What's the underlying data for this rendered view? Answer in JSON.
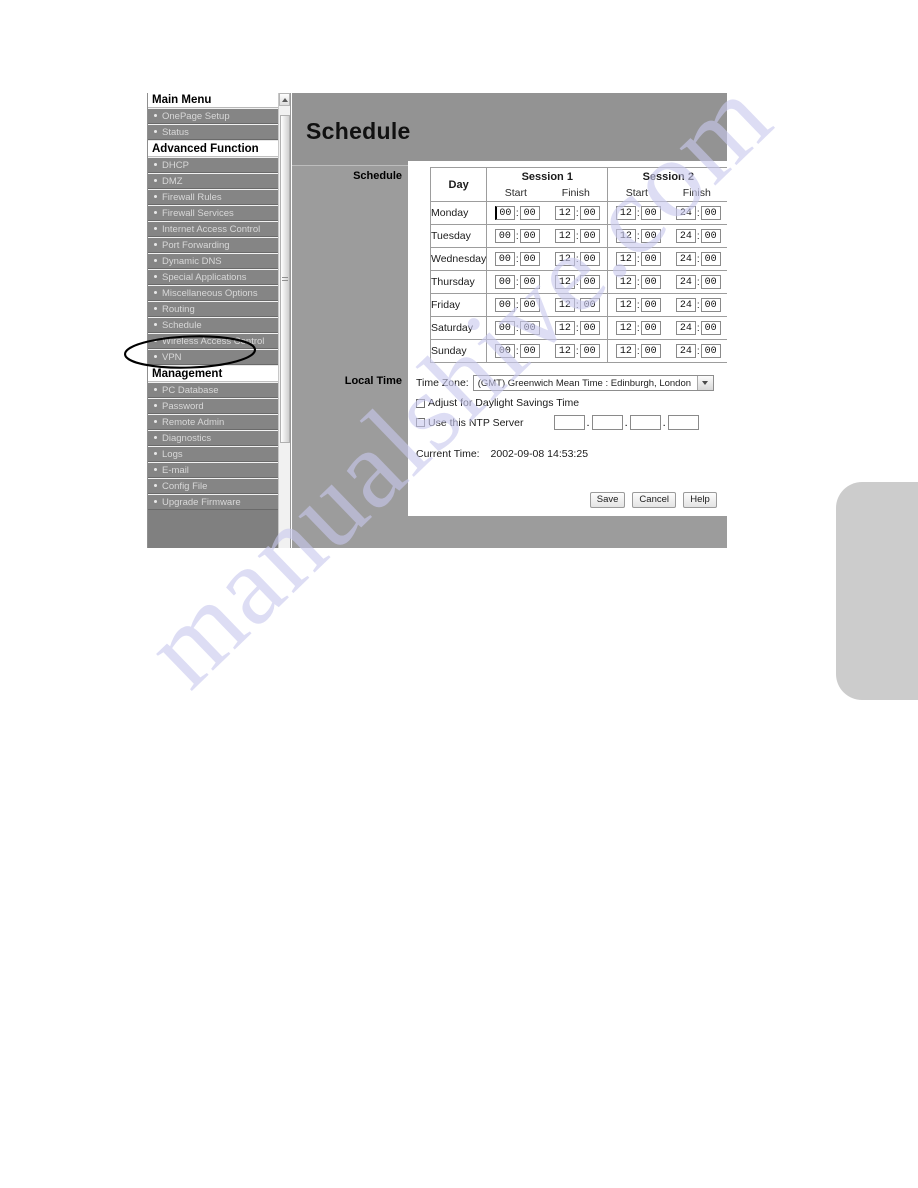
{
  "watermark": {
    "text": "manualshive.com"
  },
  "sidebar": {
    "main_menu_label": "Main Menu",
    "items_top": [
      {
        "label": "OnePage Setup"
      },
      {
        "label": "Status"
      }
    ],
    "section_advanced": "Advanced Function",
    "items_advanced": [
      {
        "label": "DHCP"
      },
      {
        "label": "DMZ"
      },
      {
        "label": "Firewall Rules"
      },
      {
        "label": "Firewall Services"
      },
      {
        "label": "Internet Access Control"
      },
      {
        "label": "Port Forwarding"
      },
      {
        "label": "Dynamic DNS"
      },
      {
        "label": "Special Applications"
      },
      {
        "label": "Miscellaneous Options"
      },
      {
        "label": "Routing"
      },
      {
        "label": "Schedule"
      },
      {
        "label": "Wireless Access Control"
      },
      {
        "label": "VPN"
      }
    ],
    "section_management": "Management",
    "items_management": [
      {
        "label": "PC Database"
      },
      {
        "label": "Password"
      },
      {
        "label": "Remote Admin"
      },
      {
        "label": "Diagnostics"
      },
      {
        "label": "Logs"
      },
      {
        "label": "E-mail"
      },
      {
        "label": "Config File"
      },
      {
        "label": "Upgrade Firmware"
      }
    ]
  },
  "content": {
    "page_title": "Schedule",
    "label_schedule": "Schedule",
    "label_local_time": "Local Time"
  },
  "schedule_table": {
    "header_day": "Day",
    "header_session1": "Session 1",
    "header_session2": "Session 2",
    "header_start": "Start",
    "header_finish": "Finish",
    "colon": ":",
    "rows": [
      {
        "day": "Monday",
        "s1_start_h": "00",
        "s1_start_m": "00",
        "s1_finish_h": "12",
        "s1_finish_m": "00",
        "s2_start_h": "12",
        "s2_start_m": "00",
        "s2_finish_h": "24",
        "s2_finish_m": "00"
      },
      {
        "day": "Tuesday",
        "s1_start_h": "00",
        "s1_start_m": "00",
        "s1_finish_h": "12",
        "s1_finish_m": "00",
        "s2_start_h": "12",
        "s2_start_m": "00",
        "s2_finish_h": "24",
        "s2_finish_m": "00"
      },
      {
        "day": "Wednesday",
        "s1_start_h": "00",
        "s1_start_m": "00",
        "s1_finish_h": "12",
        "s1_finish_m": "00",
        "s2_start_h": "12",
        "s2_start_m": "00",
        "s2_finish_h": "24",
        "s2_finish_m": "00"
      },
      {
        "day": "Thursday",
        "s1_start_h": "00",
        "s1_start_m": "00",
        "s1_finish_h": "12",
        "s1_finish_m": "00",
        "s2_start_h": "12",
        "s2_start_m": "00",
        "s2_finish_h": "24",
        "s2_finish_m": "00"
      },
      {
        "day": "Friday",
        "s1_start_h": "00",
        "s1_start_m": "00",
        "s1_finish_h": "12",
        "s1_finish_m": "00",
        "s2_start_h": "12",
        "s2_start_m": "00",
        "s2_finish_h": "24",
        "s2_finish_m": "00"
      },
      {
        "day": "Saturday",
        "s1_start_h": "00",
        "s1_start_m": "00",
        "s1_finish_h": "12",
        "s1_finish_m": "00",
        "s2_start_h": "12",
        "s2_start_m": "00",
        "s2_finish_h": "24",
        "s2_finish_m": "00"
      },
      {
        "day": "Sunday",
        "s1_start_h": "00",
        "s1_start_m": "00",
        "s1_finish_h": "12",
        "s1_finish_m": "00",
        "s2_start_h": "12",
        "s2_start_m": "00",
        "s2_finish_h": "24",
        "s2_finish_m": "00"
      }
    ]
  },
  "local_time": {
    "timezone_label": "Time Zone:",
    "timezone_value": "(GMT) Greenwich Mean Time : Edinburgh, London",
    "dst_label": "Adjust for Daylight Savings Time",
    "dst_checked": false,
    "ntp_label": "Use this NTP Server",
    "ntp_checked": false,
    "ntp_octets": [
      "",
      "",
      "",
      ""
    ],
    "separator": ".",
    "current_time_label": "Current Time:",
    "current_time_value": "2002-09-08 14:53:25"
  },
  "buttons": {
    "save": "Save",
    "cancel": "Cancel",
    "help": "Help"
  }
}
